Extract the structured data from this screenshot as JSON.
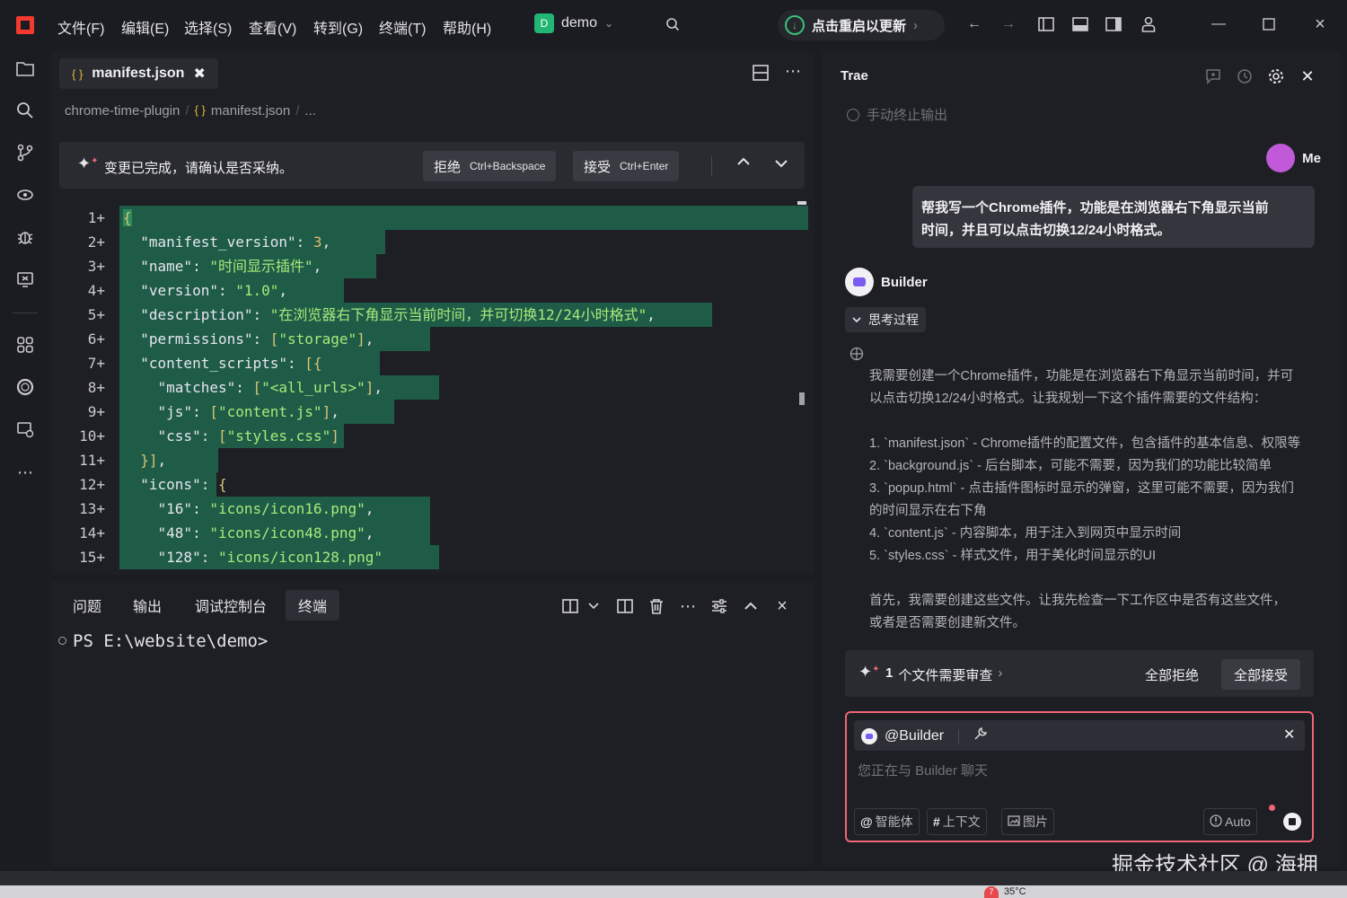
{
  "titlebar": {
    "menus": [
      "文件(F)",
      "编辑(E)",
      "选择(S)",
      "查看(V)",
      "转到(G)",
      "终端(T)",
      "帮助(H)"
    ],
    "project_badge": "D",
    "project_name": "demo",
    "update_label": "点击重启以更新"
  },
  "editor": {
    "tab_label": "manifest.json",
    "breadcrumb": [
      "chrome-time-plugin",
      "manifest.json",
      "..."
    ],
    "review_message": "变更已完成，请确认是否采纳。",
    "reject_label": "拒绝",
    "reject_shortcut": "Ctrl+Backspace",
    "accept_label": "接受",
    "accept_shortcut": "Ctrl+Enter",
    "line_numbers": [
      "1+",
      "2+",
      "3+",
      "4+",
      "5+",
      "6+",
      "7+",
      "8+",
      "9+",
      "10+",
      "11+",
      "12+",
      "13+",
      "14+",
      "15+"
    ]
  },
  "terminal": {
    "tabs": [
      "问题",
      "输出",
      "调试控制台",
      "终端"
    ],
    "active_tab": "终端",
    "prompt": "PS E:\\website\\demo>"
  },
  "chat": {
    "title": "Trae",
    "stop_output": "手动终止输出",
    "me_label": "Me",
    "user_message_line1": "帮我写一个Chrome插件，功能是在浏览器右下角显示当前",
    "user_message_line2": "时间，并且可以点击切换12/24小时格式。",
    "builder_label": "Builder",
    "think_toggle": "思考过程",
    "think_p1_l1": "我需要创建一个Chrome插件，功能是在浏览器右下角显示当前时间，并可",
    "think_p1_l2": "以点击切换12/24小时格式。让我规划一下这个插件需要的文件结构：",
    "think_list": [
      "1. `manifest.json` - Chrome插件的配置文件，包含插件的基本信息、权限等",
      "2. `background.js` - 后台脚本，可能不需要，因为我们的功能比较简单",
      "3. `popup.html` - 点击插件图标时显示的弹窗，这里可能不需要，因为我们",
      "的时间显示在右下角",
      "4. `content.js` - 内容脚本，用于注入到网页中显示时间",
      "5. `styles.css` - 样式文件，用于美化时间显示的UI"
    ],
    "think_p3_l1": "首先，我需要创建这些文件。让我先检查一下工作区中是否有这些文件，",
    "think_p3_l2": "或者是否需要创建新文件。",
    "review_count": "1",
    "review_text": "个文件需要审查",
    "reject_all": "全部拒绝",
    "accept_all": "全部接受",
    "mention": "@Builder",
    "placeholder": "您正在与 Builder 聊天",
    "chip_agent": "智能体",
    "chip_context": "上下文",
    "chip_image": "图片",
    "model": "Auto"
  },
  "watermark": "掘金技术社区 @ 海拥",
  "taskbar": {
    "weather_badge": "7",
    "temperature": "35°C"
  },
  "colors": {
    "accent_green": "#1e5c48",
    "accent_red": "#f16575",
    "logo": "#f23a2e"
  }
}
